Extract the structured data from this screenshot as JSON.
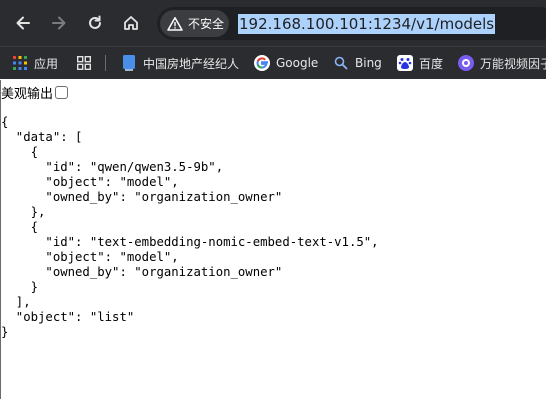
{
  "toolbar": {
    "security_label": "不安全",
    "url": "192.168.100.101:1234/v1/models"
  },
  "bookmarks": [
    {
      "label": "应用",
      "icon": "apps-grid-icon"
    },
    {
      "label": "",
      "icon": "tab-groups-icon"
    },
    {
      "label": "中国房地产经纪人",
      "icon": "bookmark-page-icon"
    },
    {
      "label": "Google",
      "icon": "google-icon"
    },
    {
      "label": "Bing",
      "icon": "search-icon"
    },
    {
      "label": "百度",
      "icon": "baidu-icon"
    },
    {
      "label": "万能视频因子",
      "icon": "video-icon"
    }
  ],
  "page": {
    "pretty_print_label": "美观输出",
    "pretty_print_checked": false,
    "json_text": "{\n  \"data\": [\n    {\n      \"id\": \"qwen/qwen3.5-9b\",\n      \"object\": \"model\",\n      \"owned_by\": \"organization_owner\"\n    },\n    {\n      \"id\": \"text-embedding-nomic-embed-text-v1.5\",\n      \"object\": \"model\",\n      \"owned_by\": \"organization_owner\"\n    }\n  ],\n  \"object\": \"list\"\n}"
  },
  "colors": {
    "toolbar_bg": "#2b2c30",
    "omnibox_bg": "#1f2023",
    "url_selection": "#acd1fb"
  }
}
